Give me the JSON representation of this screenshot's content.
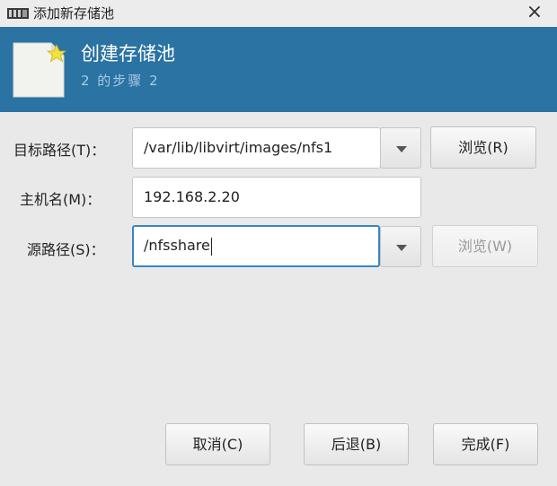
{
  "window": {
    "title": "添加新存储池",
    "close_glyph": "×",
    "icon": "vm-manager-icon"
  },
  "header": {
    "title": "创建存储池",
    "step": "2 的步骤 2",
    "icon": "new-document-icon",
    "accent_color": "#2a73a3"
  },
  "form": {
    "target_path": {
      "label": "目标路径(T)：",
      "value": "/var/lib/libvirt/images/nfs1",
      "browse_label": "浏览(R)"
    },
    "hostname": {
      "label": "主机名(M)：",
      "value": "192.168.2.20"
    },
    "source_path": {
      "label": "源路径(S)：",
      "value": "/nfsshare",
      "browse_label": "浏览(W)",
      "browse_enabled": false
    }
  },
  "footer": {
    "cancel_label": "取消(C)",
    "back_label": "后退(B)",
    "finish_label": "完成(F)"
  }
}
